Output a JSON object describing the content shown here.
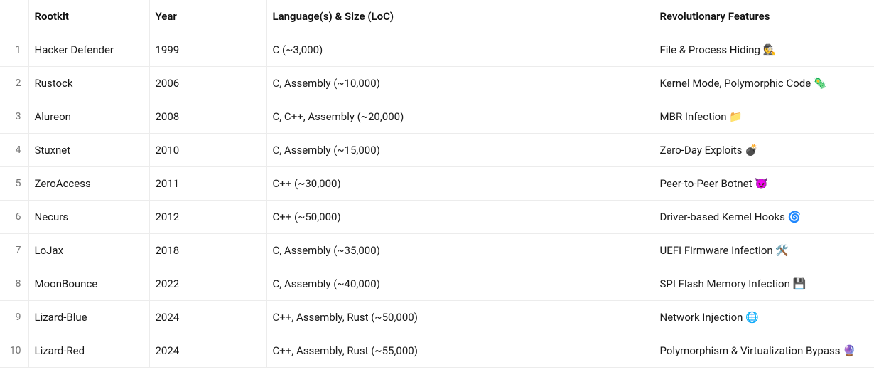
{
  "table": {
    "headers": {
      "rootkit": "Rootkit",
      "year": "Year",
      "lang": "Language(s) & Size (LoC)",
      "features": "Revolutionary Features"
    },
    "rows": [
      {
        "n": "1",
        "rootkit": "Hacker Defender",
        "year": "1999",
        "lang": "C (~3,000)",
        "features": "File & Process Hiding 🕵️"
      },
      {
        "n": "2",
        "rootkit": "Rustock",
        "year": "2006",
        "lang": "C, Assembly (~10,000)",
        "features": "Kernel Mode, Polymorphic Code 🦠"
      },
      {
        "n": "3",
        "rootkit": "Alureon",
        "year": "2008",
        "lang": "C, C++, Assembly (~20,000)",
        "features": "MBR Infection 📁"
      },
      {
        "n": "4",
        "rootkit": "Stuxnet",
        "year": "2010",
        "lang": "C, Assembly (~15,000)",
        "features": "Zero-Day Exploits 💣"
      },
      {
        "n": "5",
        "rootkit": "ZeroAccess",
        "year": "2011",
        "lang": "C++ (~30,000)",
        "features": "Peer-to-Peer Botnet 😈"
      },
      {
        "n": "6",
        "rootkit": "Necurs",
        "year": "2012",
        "lang": "C++ (~50,000)",
        "features": "Driver-based Kernel Hooks 🌀"
      },
      {
        "n": "7",
        "rootkit": "LoJax",
        "year": "2018",
        "lang": "C, Assembly (~35,000)",
        "features": "UEFI Firmware Infection 🛠️"
      },
      {
        "n": "8",
        "rootkit": "MoonBounce",
        "year": "2022",
        "lang": "C, Assembly (~40,000)",
        "features": "SPI Flash Memory Infection 💾"
      },
      {
        "n": "9",
        "rootkit": "Lizard-Blue",
        "year": "2024",
        "lang": "C++, Assembly, Rust (~50,000)",
        "features": "Network Injection 🌐"
      },
      {
        "n": "10",
        "rootkit": "Lizard-Red",
        "year": "2024",
        "lang": "C++, Assembly, Rust (~55,000)",
        "features": "Polymorphism & Virtualization Bypass 🔮"
      }
    ]
  },
  "chart_data": {
    "type": "table",
    "columns": [
      "Rootkit",
      "Year",
      "Language(s) & Size (LoC)",
      "Revolutionary Features"
    ],
    "rows": [
      [
        "Hacker Defender",
        1999,
        "C (~3,000)",
        "File & Process Hiding"
      ],
      [
        "Rustock",
        2006,
        "C, Assembly (~10,000)",
        "Kernel Mode, Polymorphic Code"
      ],
      [
        "Alureon",
        2008,
        "C, C++, Assembly (~20,000)",
        "MBR Infection"
      ],
      [
        "Stuxnet",
        2010,
        "C, Assembly (~15,000)",
        "Zero-Day Exploits"
      ],
      [
        "ZeroAccess",
        2011,
        "C++ (~30,000)",
        "Peer-to-Peer Botnet"
      ],
      [
        "Necurs",
        2012,
        "C++ (~50,000)",
        "Driver-based Kernel Hooks"
      ],
      [
        "LoJax",
        2018,
        "C, Assembly (~35,000)",
        "UEFI Firmware Infection"
      ],
      [
        "MoonBounce",
        2022,
        "C, Assembly (~40,000)",
        "SPI Flash Memory Infection"
      ],
      [
        "Lizard-Blue",
        2024,
        "C++, Assembly, Rust (~50,000)",
        "Network Injection"
      ],
      [
        "Lizard-Red",
        2024,
        "C++, Assembly, Rust (~55,000)",
        "Polymorphism & Virtualization Bypass"
      ]
    ]
  }
}
